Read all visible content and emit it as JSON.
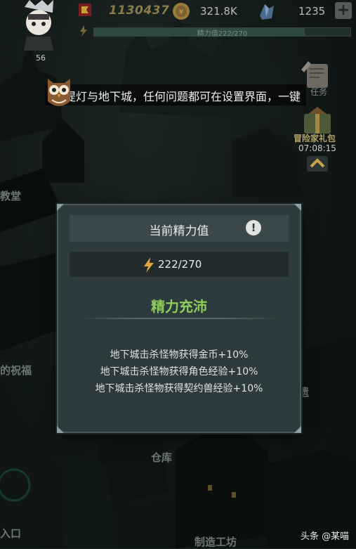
{
  "topbar": {
    "level": "56",
    "gold": "1130437",
    "coins": "321.8K",
    "gems": "1235",
    "plus_label": "+",
    "energy_text": "精力值222/270",
    "energy_fraction": 0.822
  },
  "tip": {
    "text": "提灯与地下城，任何问题都可在设置界面，一键"
  },
  "side": {
    "quest_label": "任务",
    "gift_label": "冒险家礼包",
    "gift_timer": "07:08:15"
  },
  "map_labels": {
    "church": "教堂",
    "blessing": "的祝福",
    "warehouse": "仓库",
    "entrance": "入口",
    "workshop": "制造工坊",
    "relic": "遗"
  },
  "dialog": {
    "title": "当前精力值",
    "info": "!",
    "energy": "222/270",
    "status": "精力充沛",
    "bonuses": [
      "地下城击杀怪物获得金币+10%",
      "地下城击杀怪物获得角色经验+10%",
      "地下城击杀怪物获得契约兽经验+10%"
    ]
  },
  "watermark": "头条 @某喵",
  "colors": {
    "status_green": "#8fcd5a",
    "panel": "#2e3b3e",
    "gold": "#8c7a4c"
  },
  "icons": [
    "flag-icon",
    "coin-icon",
    "gem-icon",
    "plus-icon",
    "bolt-icon",
    "owl-icon",
    "scroll-icon",
    "gift-icon",
    "chevron-up-icon",
    "info-icon"
  ]
}
